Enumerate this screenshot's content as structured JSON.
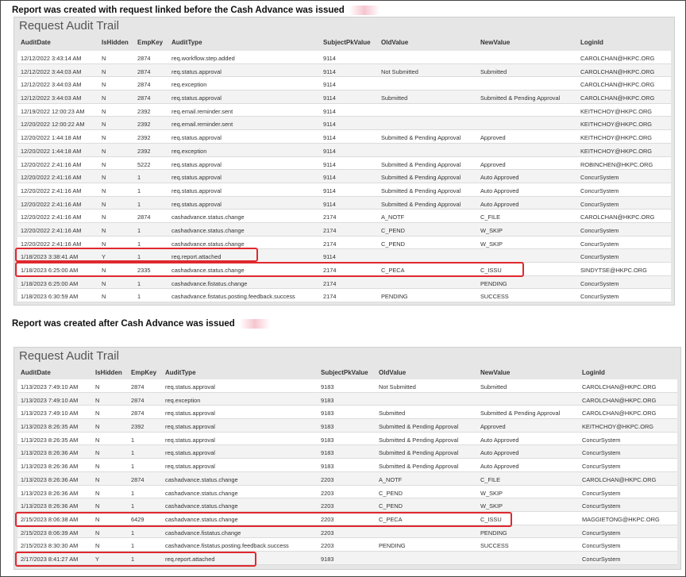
{
  "heading1": "Report was created with request linked before the Cash Advance was issued",
  "heading2": "Report was created after Cash Advance was issued",
  "panel_title": "Request Audit Trail",
  "columns": [
    "AuditDate",
    "IsHidden",
    "EmpKey",
    "AuditType",
    "SubjectPkValue",
    "OldValue",
    "NewValue",
    "LoginId"
  ],
  "table1": [
    [
      "12/12/2022 3:43:14 AM",
      "N",
      "2874",
      "req.workflow.step.added",
      "9114",
      "",
      "",
      "CAROLCHAN@HKPC.ORG"
    ],
    [
      "12/12/2022 3:44:03 AM",
      "N",
      "2874",
      "req.status.approval",
      "9114",
      "Not Submitted",
      "Submitted",
      "CAROLCHAN@HKPC.ORG"
    ],
    [
      "12/12/2022 3:44:03 AM",
      "N",
      "2874",
      "req.exception",
      "9114",
      "",
      "",
      "CAROLCHAN@HKPC.ORG"
    ],
    [
      "12/12/2022 3:44:03 AM",
      "N",
      "2874",
      "req.status.approval",
      "9114",
      "Submitted",
      "Submitted & Pending Approval",
      "CAROLCHAN@HKPC.ORG"
    ],
    [
      "12/19/2022 12:00:23 AM",
      "N",
      "2392",
      "req.email.reminder.sent",
      "9114",
      "",
      "",
      "KEITHCHOY@HKPC.ORG"
    ],
    [
      "12/20/2022 12:00:22 AM",
      "N",
      "2392",
      "req.email.reminder.sent",
      "9114",
      "",
      "",
      "KEITHCHOY@HKPC.ORG"
    ],
    [
      "12/20/2022 1:44:18 AM",
      "N",
      "2392",
      "req.status.approval",
      "9114",
      "Submitted & Pending Approval",
      "Approved",
      "KEITHCHOY@HKPC.ORG"
    ],
    [
      "12/20/2022 1:44:18 AM",
      "N",
      "2392",
      "req.exception",
      "9114",
      "",
      "",
      "KEITHCHOY@HKPC.ORG"
    ],
    [
      "12/20/2022 2:41:16 AM",
      "N",
      "5222",
      "req.status.approval",
      "9114",
      "Submitted & Pending Approval",
      "Approved",
      "ROBINCHEN@HKPC.ORG"
    ],
    [
      "12/20/2022 2:41:16 AM",
      "N",
      "1",
      "req.status.approval",
      "9114",
      "Submitted & Pending Approval",
      "Auto Approved",
      "ConcurSystem"
    ],
    [
      "12/20/2022 2:41:16 AM",
      "N",
      "1",
      "req.status.approval",
      "9114",
      "Submitted & Pending Approval",
      "Auto Approved",
      "ConcurSystem"
    ],
    [
      "12/20/2022 2:41:16 AM",
      "N",
      "1",
      "req.status.approval",
      "9114",
      "Submitted & Pending Approval",
      "Auto Approved",
      "ConcurSystem"
    ],
    [
      "12/20/2022 2:41:16 AM",
      "N",
      "2874",
      "cashadvance.status.change",
      "2174",
      "A_NOTF",
      "C_FILE",
      "CAROLCHAN@HKPC.ORG"
    ],
    [
      "12/20/2022 2:41:16 AM",
      "N",
      "1",
      "cashadvance.status.change",
      "2174",
      "C_PEND",
      "W_SKIP",
      "ConcurSystem"
    ],
    [
      "12/20/2022 2:41:16 AM",
      "N",
      "1",
      "cashadvance.status.change",
      "2174",
      "C_PEND",
      "W_SKIP",
      "ConcurSystem"
    ],
    [
      "1/18/2023 3:38:41 AM",
      "Y",
      "1",
      "req.report.attached",
      "9114",
      "",
      "",
      "ConcurSystem"
    ],
    [
      "1/18/2023 6:25:00 AM",
      "N",
      "2335",
      "cashadvance.status.change",
      "2174",
      "C_PECA",
      "C_ISSU",
      "SINDYTSE@HKPC.ORG"
    ],
    [
      "1/18/2023 6:25:00 AM",
      "N",
      "1",
      "cashadvance.fistatus.change",
      "2174",
      "",
      "PENDING",
      "ConcurSystem"
    ],
    [
      "1/18/2023 6:30:59 AM",
      "N",
      "1",
      "cashadvance.fistatus.posting.feedback.success",
      "2174",
      "PENDING",
      "SUCCESS",
      "ConcurSystem"
    ]
  ],
  "table2": [
    [
      "1/13/2023 7:49:10 AM",
      "N",
      "2874",
      "req.status.approval",
      "9183",
      "Not Submitted",
      "Submitted",
      "CAROLCHAN@HKPC.ORG"
    ],
    [
      "1/13/2023 7:49:10 AM",
      "N",
      "2874",
      "req.exception",
      "9183",
      "",
      "",
      "CAROLCHAN@HKPC.ORG"
    ],
    [
      "1/13/2023 7:49:10 AM",
      "N",
      "2874",
      "req.status.approval",
      "9183",
      "Submitted",
      "Submitted & Pending Approval",
      "CAROLCHAN@HKPC.ORG"
    ],
    [
      "1/13/2023 8:26:35 AM",
      "N",
      "2392",
      "req.status.approval",
      "9183",
      "Submitted & Pending Approval",
      "Approved",
      "KEITHCHOY@HKPC.ORG"
    ],
    [
      "1/13/2023 8:26:35 AM",
      "N",
      "1",
      "req.status.approval",
      "9183",
      "Submitted & Pending Approval",
      "Auto Approved",
      "ConcurSystem"
    ],
    [
      "1/13/2023 8:26:36 AM",
      "N",
      "1",
      "req.status.approval",
      "9183",
      "Submitted & Pending Approval",
      "Auto Approved",
      "ConcurSystem"
    ],
    [
      "1/13/2023 8:26:36 AM",
      "N",
      "1",
      "req.status.approval",
      "9183",
      "Submitted & Pending Approval",
      "Auto Approved",
      "ConcurSystem"
    ],
    [
      "1/13/2023 8:26:36 AM",
      "N",
      "2874",
      "cashadvance.status.change",
      "2203",
      "A_NOTF",
      "C_FILE",
      "CAROLCHAN@HKPC.ORG"
    ],
    [
      "1/13/2023 8:26:36 AM",
      "N",
      "1",
      "cashadvance.status.change",
      "2203",
      "C_PEND",
      "W_SKIP",
      "ConcurSystem"
    ],
    [
      "1/13/2023 8:26:36 AM",
      "N",
      "1",
      "cashadvance.status.change",
      "2203",
      "C_PEND",
      "W_SKIP",
      "ConcurSystem"
    ],
    [
      "2/15/2023 8:06:38 AM",
      "N",
      "6429",
      "cashadvance.status.change",
      "2203",
      "C_PECA",
      "C_ISSU",
      "MAGGIETONG@HKPC.ORG"
    ],
    [
      "2/15/2023 8:06:39 AM",
      "N",
      "1",
      "cashadvance.fistatus.change",
      "2203",
      "",
      "PENDING",
      "ConcurSystem"
    ],
    [
      "2/15/2023 8:30:30 AM",
      "N",
      "1",
      "cashadvance.fistatus.posting.feedback.success",
      "2203",
      "PENDING",
      "SUCCESS",
      "ConcurSystem"
    ],
    [
      "2/17/2023 8:41:27 AM",
      "Y",
      "1",
      "req.report.attached",
      "9183",
      "",
      "",
      "ConcurSystem"
    ]
  ],
  "colors": {
    "highlight": "#e0282f",
    "panel": "#e6e6e6"
  }
}
